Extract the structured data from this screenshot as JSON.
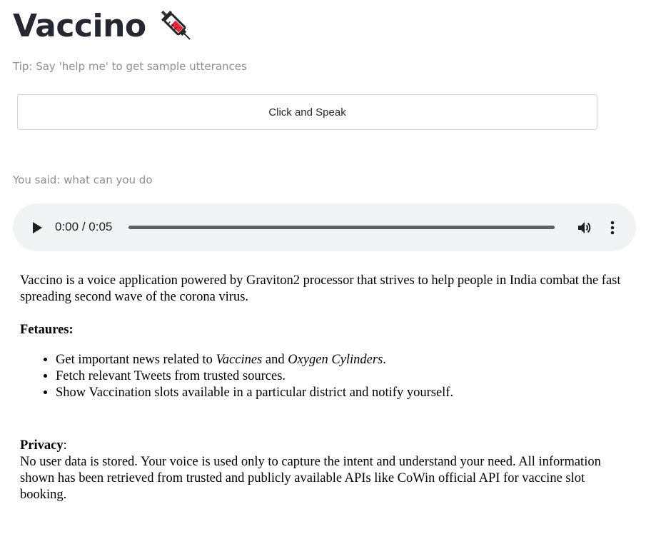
{
  "header": {
    "title": "Vaccino",
    "title_icon": "syringe-icon"
  },
  "tip": "Tip: Say 'help me' to get sample utterances",
  "speak_button": {
    "label": "Click and Speak"
  },
  "you_said": "You said: what can you do",
  "audio_player": {
    "current_time": "0:00",
    "separator": " / ",
    "duration": "0:05",
    "progress": 1.0,
    "icons": [
      "play-icon",
      "volume-icon",
      "more-vert-icon"
    ]
  },
  "description": {
    "intro": "Vaccino is a voice application powered by Graviton2 processor that strives to help people in India combat the fast spreading second wave of the corona virus.",
    "features_heading": "Fetaures:",
    "features": [
      {
        "prefix": "Get important news related to ",
        "em1": "Vaccines",
        "mid": " and ",
        "em2": "Oxygen Cylinders",
        "suffix": "."
      },
      {
        "text": "Fetch relevant Tweets from trusted sources."
      },
      {
        "text": "Show Vaccination slots available in a particular district and notify yourself."
      }
    ],
    "privacy_heading": "Privacy",
    "privacy_colon": ":",
    "privacy_text": "No user data is stored. Your voice is used only to capture the intent and understand your need. All information shown has been retrieved from trusted and publicly available APIs like CoWin official API for vaccine slot booking."
  },
  "colors": {
    "text": "#262730",
    "muted": "#8b8d97",
    "player_bg": "#f1f3f4",
    "button_border": "#d1d3d9"
  }
}
